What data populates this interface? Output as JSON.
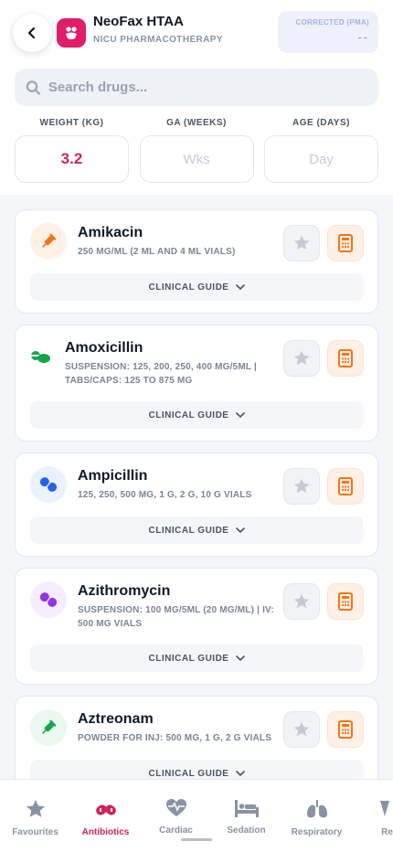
{
  "header": {
    "title": "NeoFax HTAA",
    "subtitle": "NICU PHARMACOTHERAPY",
    "pma_label": "CORRECTED (PMA)",
    "pma_value": "--"
  },
  "search": {
    "placeholder": "Search drugs..."
  },
  "fields": {
    "weight": {
      "label": "WEIGHT (KG)",
      "value": "3.2"
    },
    "ga": {
      "label": "GA (WEEKS)",
      "placeholder": "Wks"
    },
    "age": {
      "label": "AGE (DAYS)",
      "placeholder": "Day"
    }
  },
  "guide_label": "CLINICAL GUIDE",
  "drugs": [
    {
      "name": "Amikacin",
      "desc": "250 MG/ML (2 ML AND 4 ML VIALS)",
      "icon": "syringe-icon",
      "icon_color": "#f97316",
      "icon_bg": "#fff1e6"
    },
    {
      "name": "Amoxicillin",
      "desc": "SUSPENSION: 125, 200, 250, 400 MG/5ML | TABS/CAPS: 125 TO 875 MG",
      "icon": "pill-icon",
      "icon_color": "#16a34a",
      "icon_bg": "#ffffff"
    },
    {
      "name": "Ampicillin",
      "desc": "125, 250, 500 MG, 1 G, 2 G, 10 G VIALS",
      "icon": "capsule-icon",
      "icon_color": "#2563eb",
      "icon_bg": "#eaf1ff"
    },
    {
      "name": "Azithromycin",
      "desc": "SUSPENSION: 100 MG/5ML (20 MG/ML) | IV: 500 MG VIALS",
      "icon": "capsule-icon",
      "icon_color": "#9333ea",
      "icon_bg": "#f5eefe"
    },
    {
      "name": "Aztreonam",
      "desc": "POWDER FOR INJ: 500 MG, 1 G, 2 G VIALS",
      "icon": "syringe-icon",
      "icon_color": "#16a34a",
      "icon_bg": "#eaf8ee"
    }
  ],
  "nav": [
    {
      "label": "Favourites",
      "icon": "star-icon"
    },
    {
      "label": "Antibiotics",
      "icon": "capsule-icon",
      "active": true
    },
    {
      "label": "Cardiac",
      "icon": "heart-pulse-icon"
    },
    {
      "label": "Sedation",
      "icon": "bed-icon"
    },
    {
      "label": "Respiratory",
      "icon": "lungs-icon"
    },
    {
      "label": "Re",
      "icon": "partial-icon"
    }
  ],
  "colors": {
    "accent": "#d0235f",
    "calc": "#f97316"
  }
}
